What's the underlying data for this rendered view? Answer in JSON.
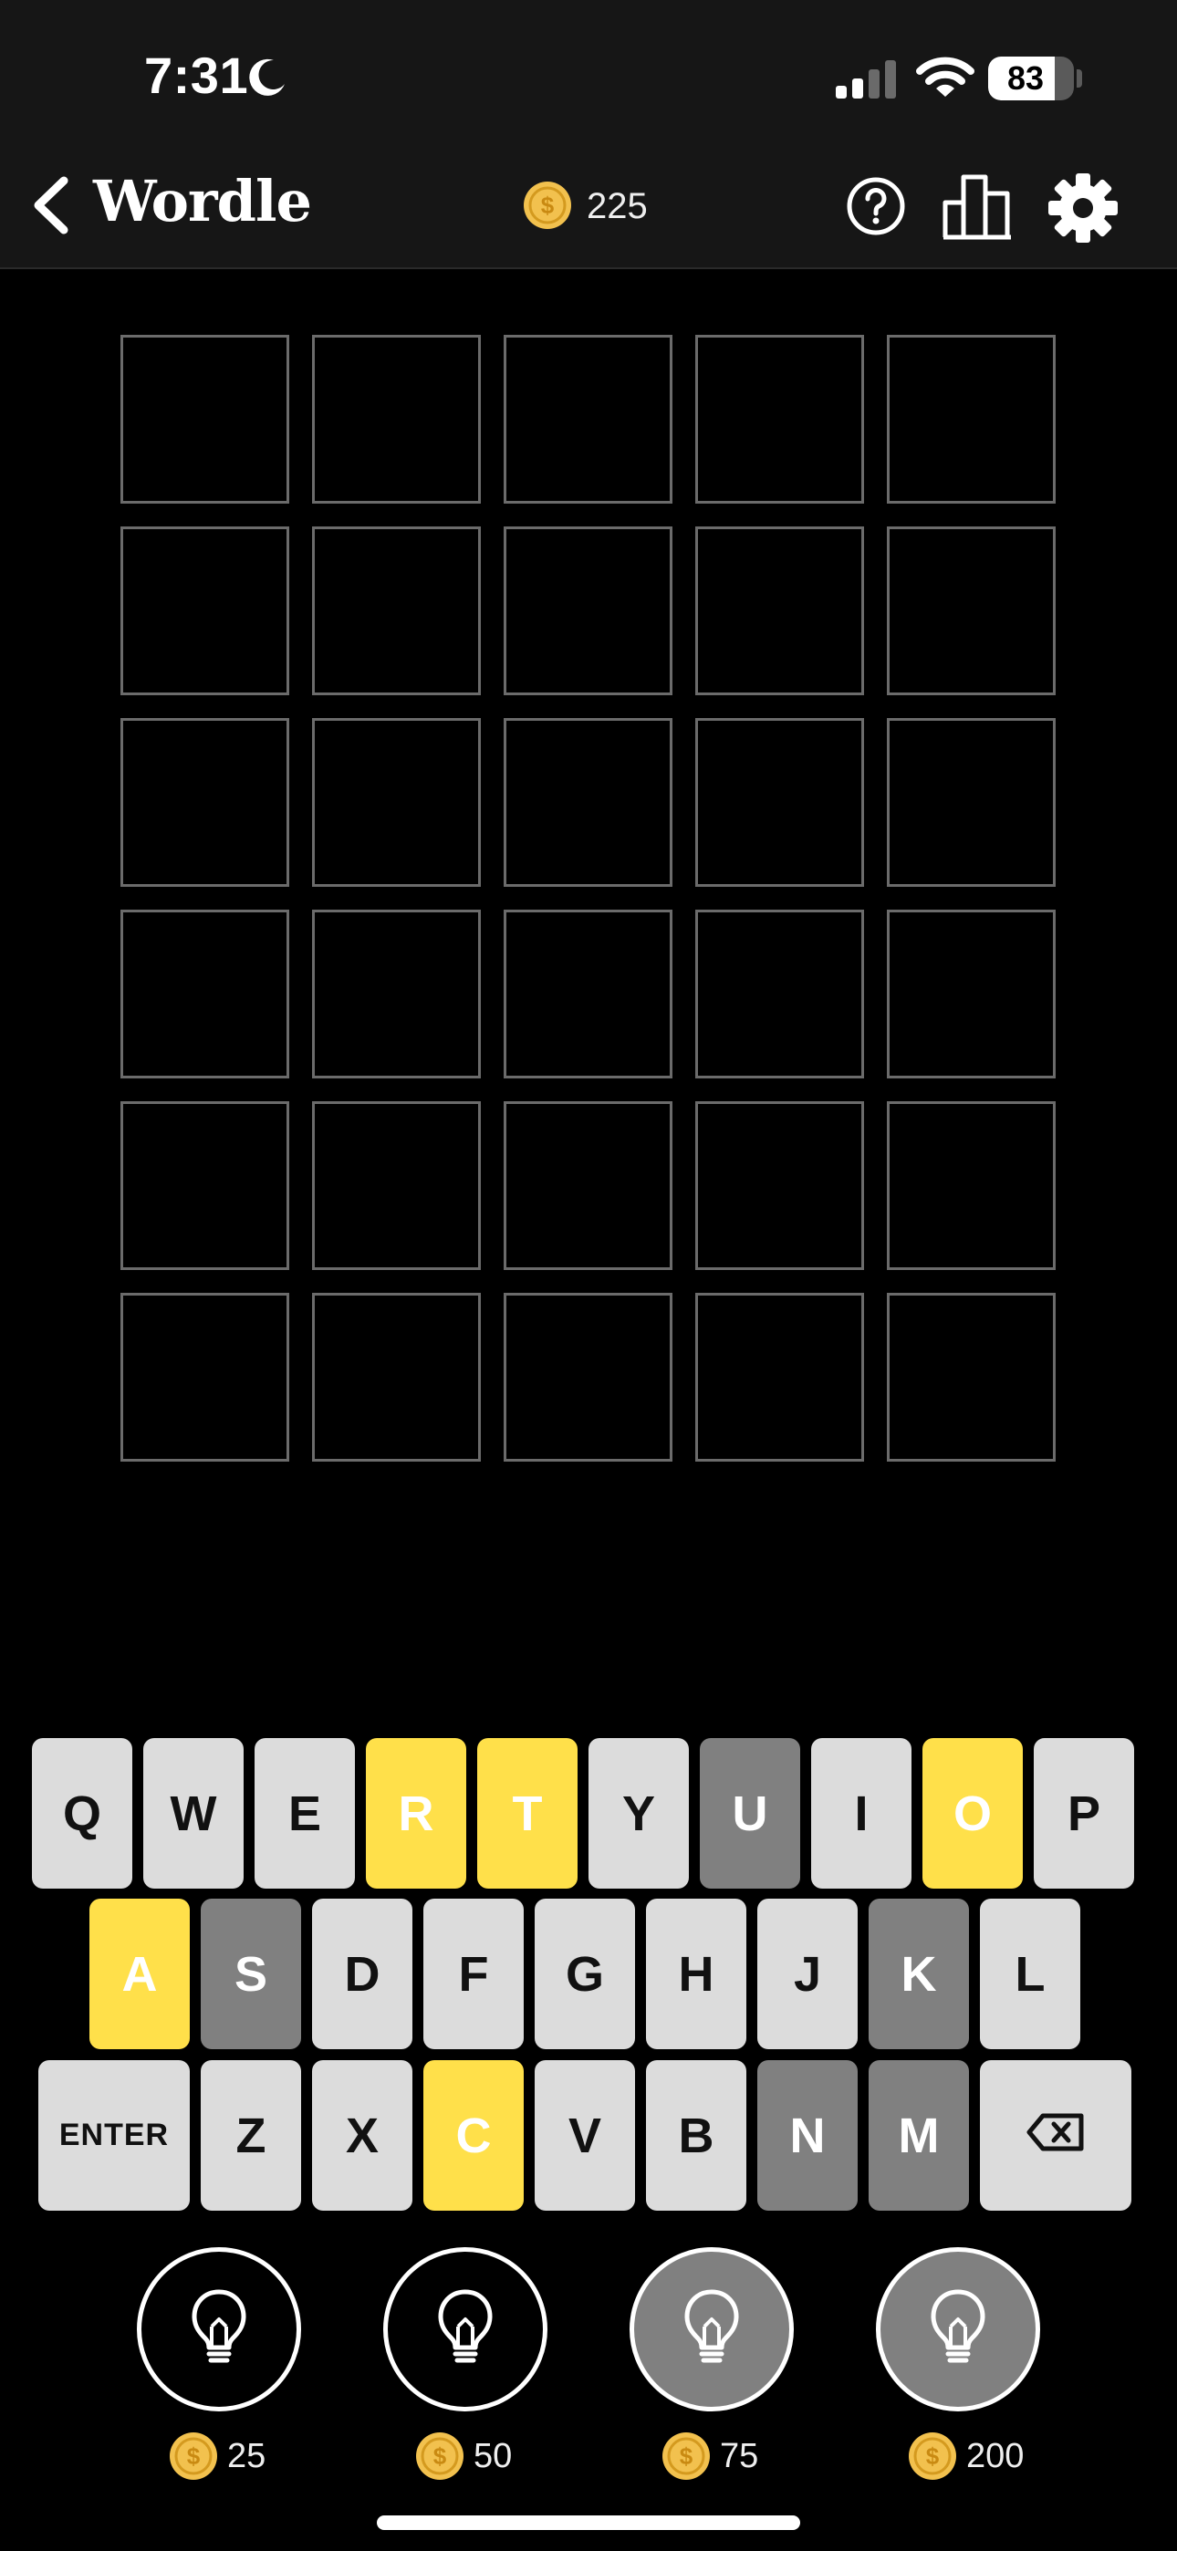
{
  "status_bar": {
    "time": "7:31",
    "battery_percent": "83",
    "battery_level": 0.83
  },
  "header": {
    "title": "Wordle",
    "coins": "225",
    "icons": [
      "back-icon",
      "coin-icon",
      "help-icon",
      "stats-icon",
      "settings-icon"
    ]
  },
  "grid": {
    "rows": [
      [
        "",
        "",
        "",
        "",
        ""
      ],
      [
        "",
        "",
        "",
        "",
        ""
      ],
      [
        "",
        "",
        "",
        "",
        ""
      ],
      [
        "",
        "",
        "",
        "",
        ""
      ],
      [
        "",
        "",
        "",
        "",
        ""
      ],
      [
        "",
        "",
        "",
        "",
        ""
      ]
    ]
  },
  "keyboard": {
    "rows": [
      [
        {
          "label": "Q",
          "state": "default"
        },
        {
          "label": "W",
          "state": "default"
        },
        {
          "label": "E",
          "state": "default"
        },
        {
          "label": "R",
          "state": "present"
        },
        {
          "label": "T",
          "state": "present"
        },
        {
          "label": "Y",
          "state": "default"
        },
        {
          "label": "U",
          "state": "absent"
        },
        {
          "label": "I",
          "state": "default"
        },
        {
          "label": "O",
          "state": "present"
        },
        {
          "label": "P",
          "state": "default"
        }
      ],
      [
        {
          "label": "A",
          "state": "present"
        },
        {
          "label": "S",
          "state": "absent"
        },
        {
          "label": "D",
          "state": "default"
        },
        {
          "label": "F",
          "state": "default"
        },
        {
          "label": "G",
          "state": "default"
        },
        {
          "label": "H",
          "state": "default"
        },
        {
          "label": "J",
          "state": "default"
        },
        {
          "label": "K",
          "state": "absent"
        },
        {
          "label": "L",
          "state": "default"
        }
      ],
      [
        {
          "label": "ENTER",
          "state": "default"
        },
        {
          "label": "Z",
          "state": "default"
        },
        {
          "label": "X",
          "state": "default"
        },
        {
          "label": "C",
          "state": "present"
        },
        {
          "label": "V",
          "state": "default"
        },
        {
          "label": "B",
          "state": "default"
        },
        {
          "label": "N",
          "state": "absent"
        },
        {
          "label": "M",
          "state": "absent"
        },
        {
          "label": "",
          "state": "default",
          "icon": "backspace-icon"
        }
      ]
    ]
  },
  "hints": [
    {
      "cost": "25",
      "locked": false,
      "icon": "lightbulb-icon"
    },
    {
      "cost": "50",
      "locked": false,
      "icon": "lightbulb-icon"
    },
    {
      "cost": "75",
      "locked": true,
      "icon": "lightbulb-icon"
    },
    {
      "cost": "200",
      "locked": true,
      "icon": "lightbulb-icon"
    }
  ],
  "colors": {
    "present": "#ffe04a",
    "absent": "#808080",
    "key_default": "#dcdcdc",
    "tile_border": "#6b6b6b",
    "coin": "#f2c14e",
    "header_bg": "#161616"
  }
}
